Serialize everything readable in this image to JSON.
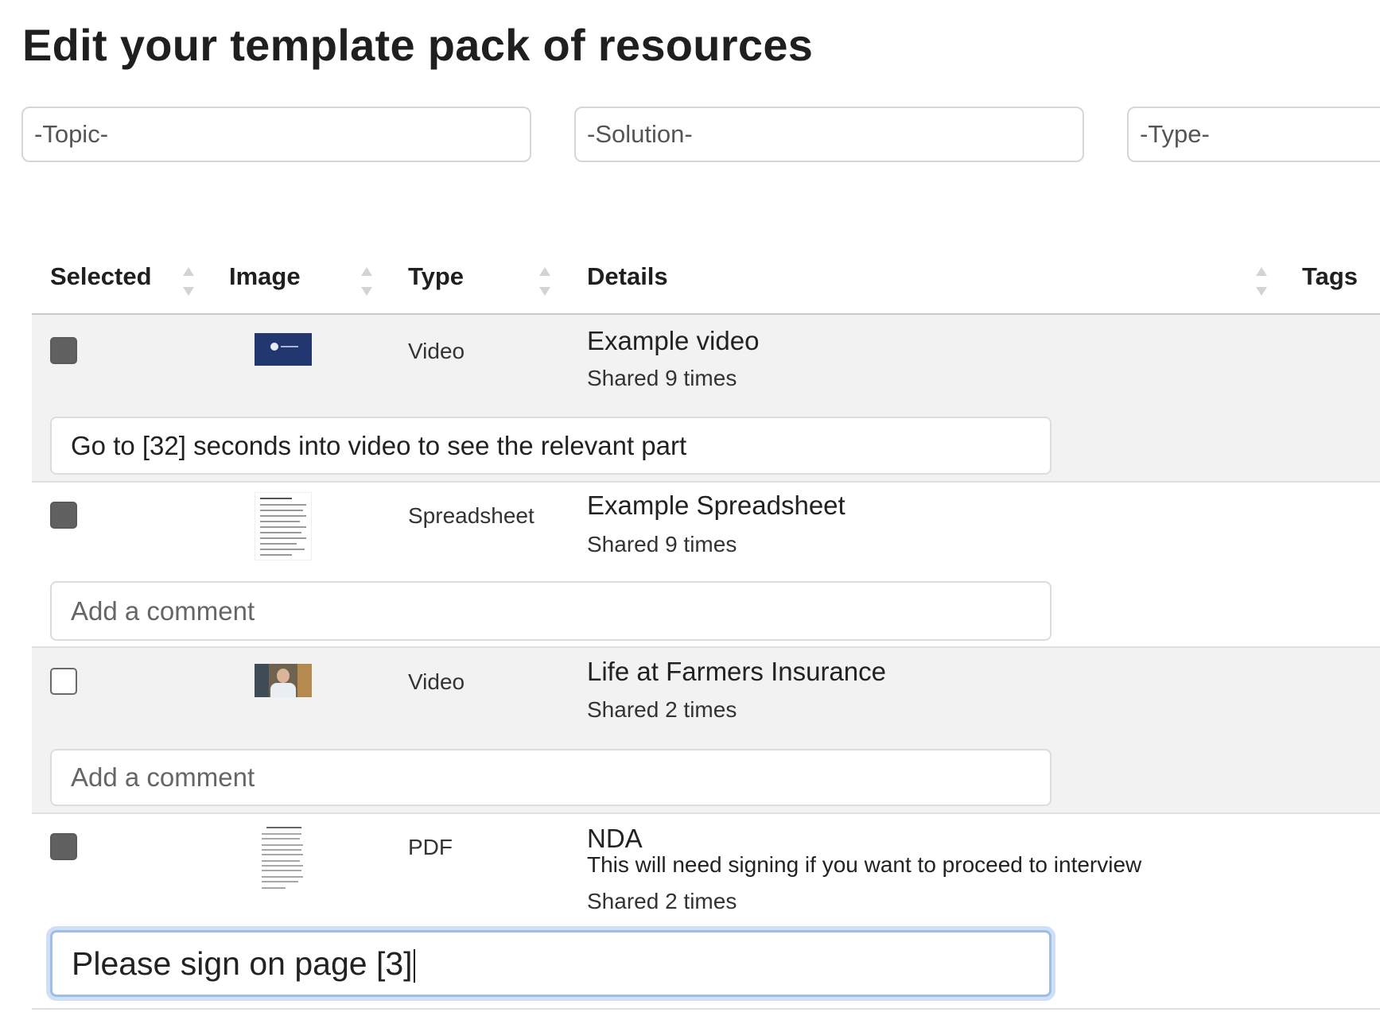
{
  "page": {
    "title": "Edit your template pack of resources"
  },
  "filters": {
    "topic": "-Topic-",
    "solution": "-Solution-",
    "type": "-Type-"
  },
  "table": {
    "headers": {
      "selected": "Selected",
      "image": "Image",
      "type": "Type",
      "details": "Details",
      "tags": "Tags"
    },
    "rows": [
      {
        "selected": true,
        "type": "Video",
        "title": "Example video",
        "description": "",
        "shared": "Shared 9 times",
        "comment": "Go to [32] seconds into video to see the relevant part",
        "comment_is_placeholder": false,
        "image": "video-thumbnail"
      },
      {
        "selected": true,
        "type": "Spreadsheet",
        "title": "Example Spreadsheet",
        "description": "",
        "shared": "Shared 9 times",
        "comment": "Add a comment",
        "comment_is_placeholder": true,
        "image": "spreadsheet-thumbnail"
      },
      {
        "selected": false,
        "type": "Video",
        "title": "Life at Farmers Insurance",
        "description": "",
        "shared": "Shared 2 times",
        "comment": "Add a comment",
        "comment_is_placeholder": true,
        "image": "person-video-thumbnail"
      },
      {
        "selected": true,
        "type": "PDF",
        "title": "NDA",
        "description": "This will need signing if you want to proceed to interview",
        "shared": "Shared 2 times",
        "comment": "Please sign on page [3]",
        "comment_is_placeholder": false,
        "comment_focused": true,
        "image": "pdf-thumbnail"
      }
    ]
  },
  "colors": {
    "checkbox_checked": "#616161",
    "row_shaded": "#f2f2f2",
    "focus_ring": "#9fbde6"
  }
}
